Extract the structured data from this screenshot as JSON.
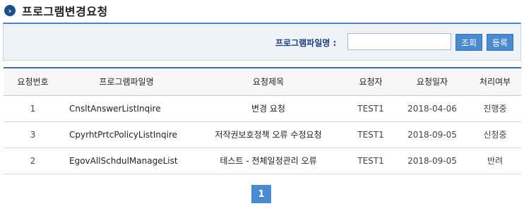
{
  "header": {
    "title": "프로그램변경요청",
    "icon": "chevron-right-circle-icon"
  },
  "search": {
    "label": "프로그램파일명 :",
    "value": "",
    "placeholder": "",
    "search_button": "조회",
    "register_button": "등록"
  },
  "table": {
    "columns": [
      "요청번호",
      "프로그램파일명",
      "요청제목",
      "요청자",
      "요청일자",
      "처리여부"
    ],
    "rows": [
      {
        "no": "1",
        "file": "CnsltAnswerListInqire",
        "subject": "변경 요청",
        "requester": "TEST1",
        "date": "2018-04-06",
        "status": "진행중"
      },
      {
        "no": "3",
        "file": "CpyrhtPrtcPolicyListInqire",
        "subject": "저작권보호정책 오류 수정요청",
        "requester": "TEST1",
        "date": "2018-09-05",
        "status": "신청중"
      },
      {
        "no": "2",
        "file": "EgovAllSchdulManageList",
        "subject": "테스트 - 전체일정관리 오류",
        "requester": "TEST1",
        "date": "2018-09-05",
        "status": "반려"
      }
    ]
  },
  "pagination": {
    "current": "1"
  },
  "colors": {
    "accent": "#4a8bd0",
    "header_border": "#3c6fb0",
    "search_bg": "#eef3fa"
  }
}
